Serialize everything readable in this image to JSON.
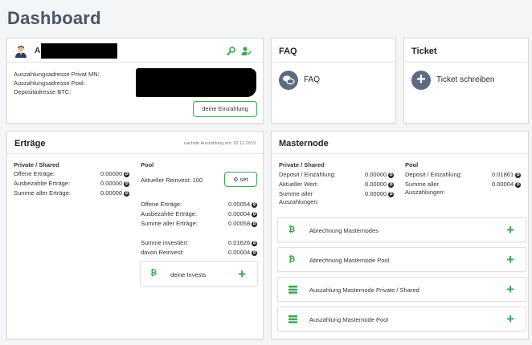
{
  "page": {
    "title": "Dashboard"
  },
  "profile": {
    "name_initial": "A",
    "addr_mn_label": "Auszahlungsadresse Privat MN:",
    "addr_pool_label": "Auszahlungsadresse Pool:",
    "deposit_label": "Depositadresse BTC:",
    "deposit_button": "deine Einzahlung"
  },
  "faq": {
    "title": "FAQ",
    "link": "FAQ"
  },
  "ticket": {
    "title": "Ticket",
    "link": "Ticket schreiben"
  },
  "ertraege": {
    "title": "Erträge",
    "next_payout": "nächste Auszahlung am: 02.12.2019",
    "private_heading": "Private / Shared",
    "private_rows": [
      {
        "label": "Offene Erträge:",
        "value": "0.00000"
      },
      {
        "label": "Ausbezahlte Erträge:",
        "value": "0.00000"
      },
      {
        "label": "Summe aller Erträge:",
        "value": "0.00000"
      }
    ],
    "pool_heading": "Pool",
    "reinvest_label": "Aktueller Reinvest: 100",
    "set_button": "set",
    "pool_rows": [
      {
        "label": "Offene Erträge:",
        "value": "0.00054"
      },
      {
        "label": "Ausbezahlte Erträge:",
        "value": "0.00004"
      },
      {
        "label": "Summe aller Erträge:",
        "value": "0.00058"
      }
    ],
    "invest_rows": [
      {
        "label": "Summe investiert:",
        "value": "0.01626"
      },
      {
        "label": "davon Reinvest:",
        "value": "0.00004"
      }
    ],
    "invests_button": "deine Invests"
  },
  "masternode": {
    "title": "Masternode",
    "private_heading": "Private / Shared",
    "private_rows": [
      {
        "label": "Deposit / Einzahlung:",
        "value": "0.00000"
      },
      {
        "label": "Aktueller Wert:",
        "value": "0.00000"
      },
      {
        "label_line1": "Summe aller",
        "label_line2": "Auszahlungen:",
        "value": "0.00000"
      }
    ],
    "pool_heading": "Pool",
    "pool_rows": [
      {
        "label": "Deposit / Einzahlung:",
        "value": "0.01861"
      },
      {
        "label_line1": "Summe aller",
        "label_line2": "Auszahlungen:",
        "value": "0.00004"
      }
    ],
    "items": [
      {
        "label": "Abrechnung Masternodes",
        "icon": "bitcoin-icon"
      },
      {
        "label": "Abrechnung Masternode Pool",
        "icon": "bitcoin-icon"
      },
      {
        "label": "Auszahlung Masternode Private / Shared",
        "icon": "money-stack-icon"
      },
      {
        "label": "Auszahlung Masternode Pool",
        "icon": "money-stack-icon"
      }
    ]
  },
  "colors": {
    "accent": "#3aa655",
    "title": "#4a5565",
    "faq_icon": "#5d6b80"
  }
}
